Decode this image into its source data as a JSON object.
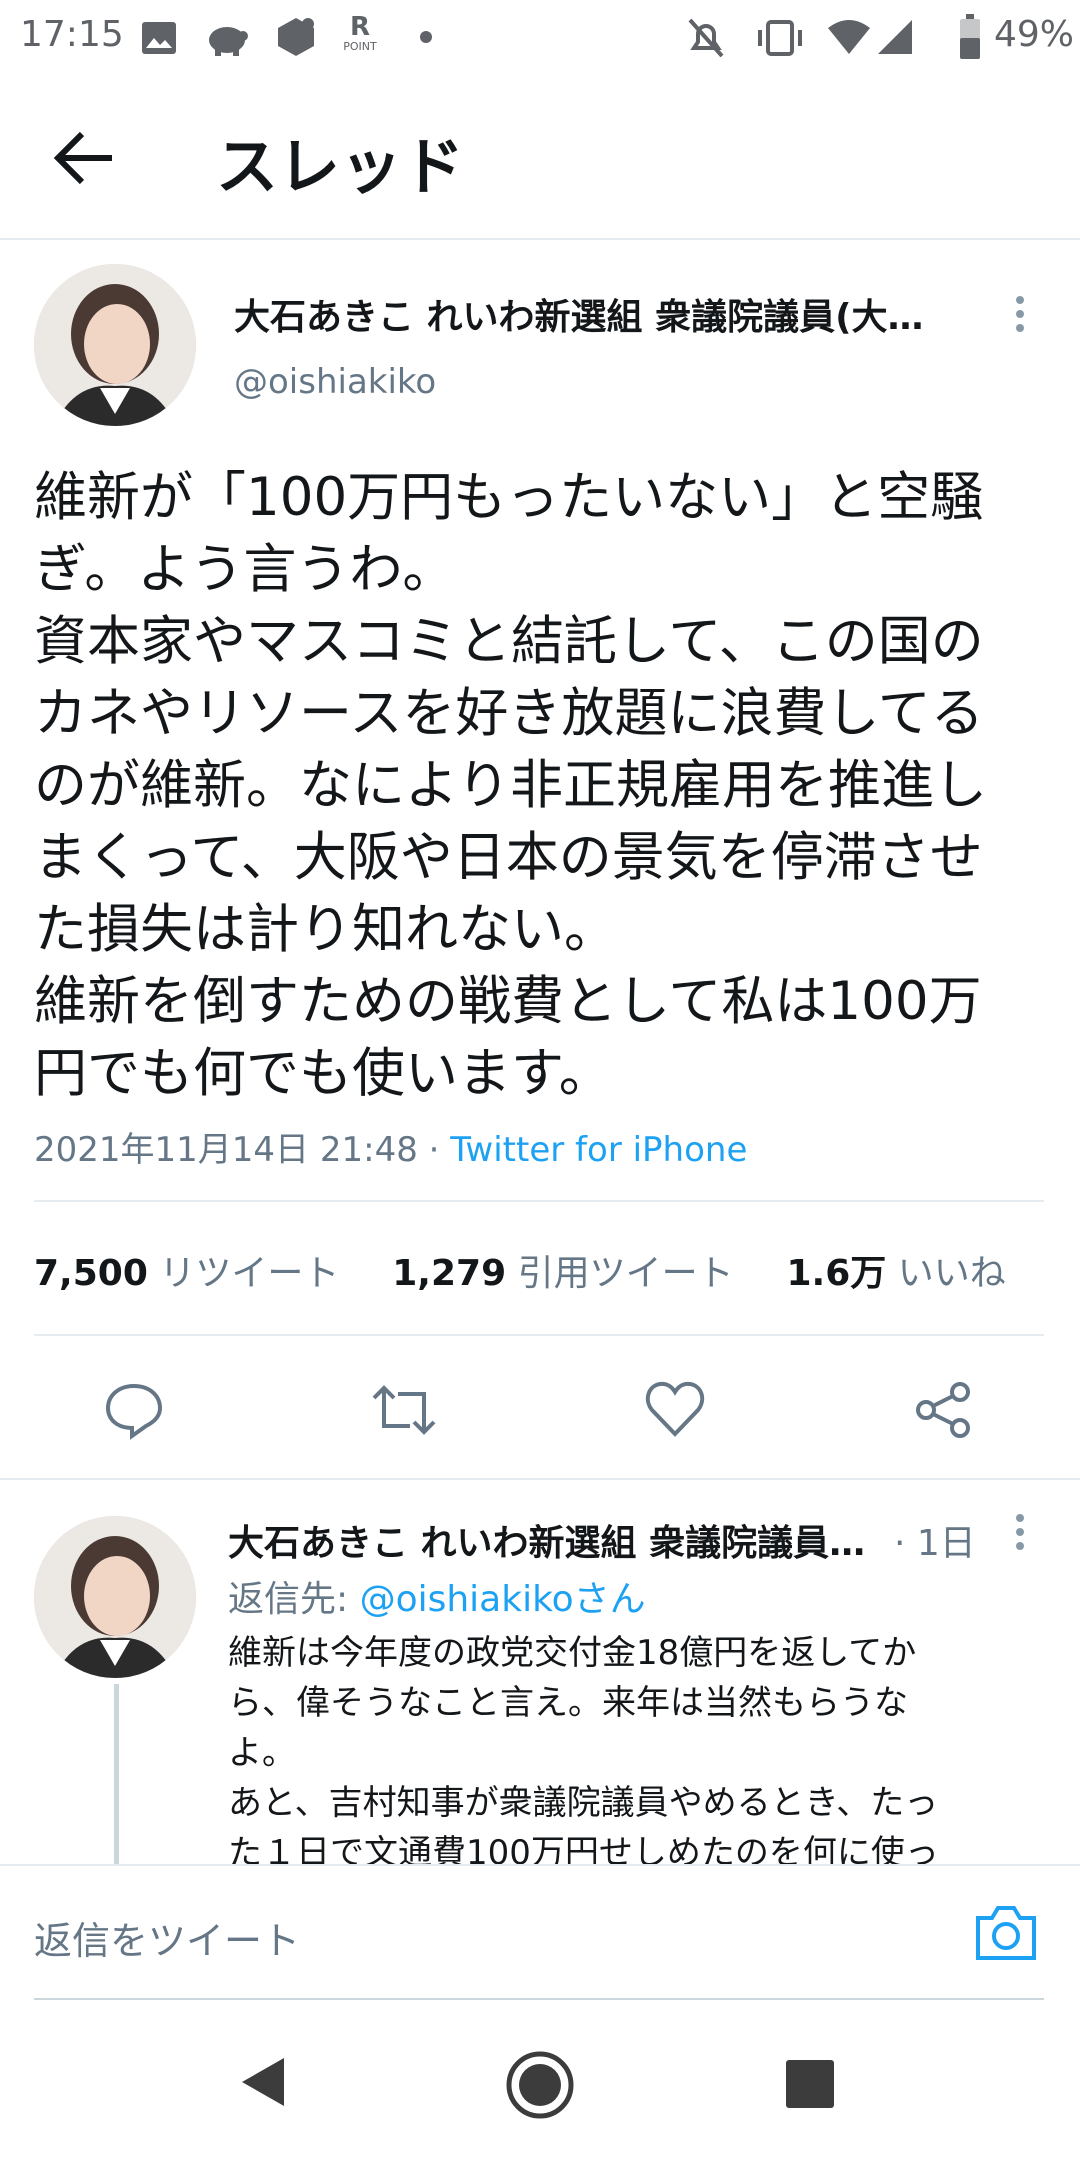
{
  "status_bar": {
    "time": "17:15",
    "point_label": "POINT",
    "battery": "49%"
  },
  "header": {
    "title": "スレッド"
  },
  "main_tweet": {
    "author_name": "大石あきこ れいわ新選組 衆議院議員(大…",
    "handle": "@oishiakiko",
    "text": "維新が「100万円もったいない」と空騒\nぎ。よう言うわ。\n資本家やマスコミと結託して、この国の\nカネやリソースを好き放題に浪費してる\nのが維新。なにより非正規雇用を推進し\nまくって、大阪や日本の景気を停滞させ\nた損失は計り知れない。\n維新を倒すための戦費として私は100万\n円でも何でも使います。",
    "date": "2021年11月14日 21:48 · ",
    "source": "Twitter for iPhone",
    "retweets_count": "7,500",
    "retweets_label": "リツイート",
    "quotes_count": "1,279",
    "quotes_label": "引用ツイート",
    "likes_count": "1.6万",
    "likes_label": "いいね"
  },
  "reply_tweet": {
    "author_name": "大石あきこ れいわ新選組 衆議院議員…",
    "time": "· 1日",
    "reply_to_prefix": "返信先: ",
    "reply_to_handle": "@oishiakikoさん",
    "text": "維新は今年度の政党交付金18億円を返してか\nら、偉そうなこと言え。来年は当然もらうな\nよ。\nあと、吉村知事が衆議院議員やめるとき、たっ\nた１日で文通費100万円せしめたのを何に使っ"
  },
  "compose": {
    "placeholder": "返信をツイート"
  },
  "colors": {
    "accent": "#1da1f2",
    "secondary_text": "#657786",
    "divider": "#e6ecf0"
  }
}
